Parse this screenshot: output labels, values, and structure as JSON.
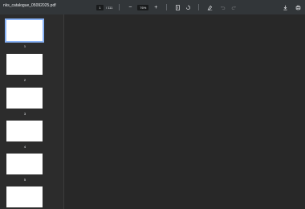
{
  "toolbar": {
    "title": "nks_catalogue_05092025.pdf",
    "page_current": "1",
    "page_total": "/ 111",
    "zoom": "76%",
    "zoom_out_symbol": "−",
    "zoom_in_symbol": "+",
    "icons": [
      "zoom-out-icon",
      "zoom-in-icon",
      "fit-page-icon",
      "rotate-icon",
      "annotate-icon",
      "undo-icon",
      "redo-icon",
      "download-icon",
      "print-icon"
    ]
  },
  "sidebar": {
    "thumbnails": [
      {
        "label": "1",
        "selected": true
      },
      {
        "label": "2",
        "selected": false
      },
      {
        "label": "3",
        "selected": false
      },
      {
        "label": "4",
        "selected": false
      },
      {
        "label": "5",
        "selected": false
      },
      {
        "label": "6",
        "selected": false
      }
    ]
  },
  "colors": {
    "toolbar_bg": "#323639",
    "sidebar_bg": "#2c2c2c",
    "main_bg": "#282828",
    "selection_outline": "#8ab4f8"
  }
}
